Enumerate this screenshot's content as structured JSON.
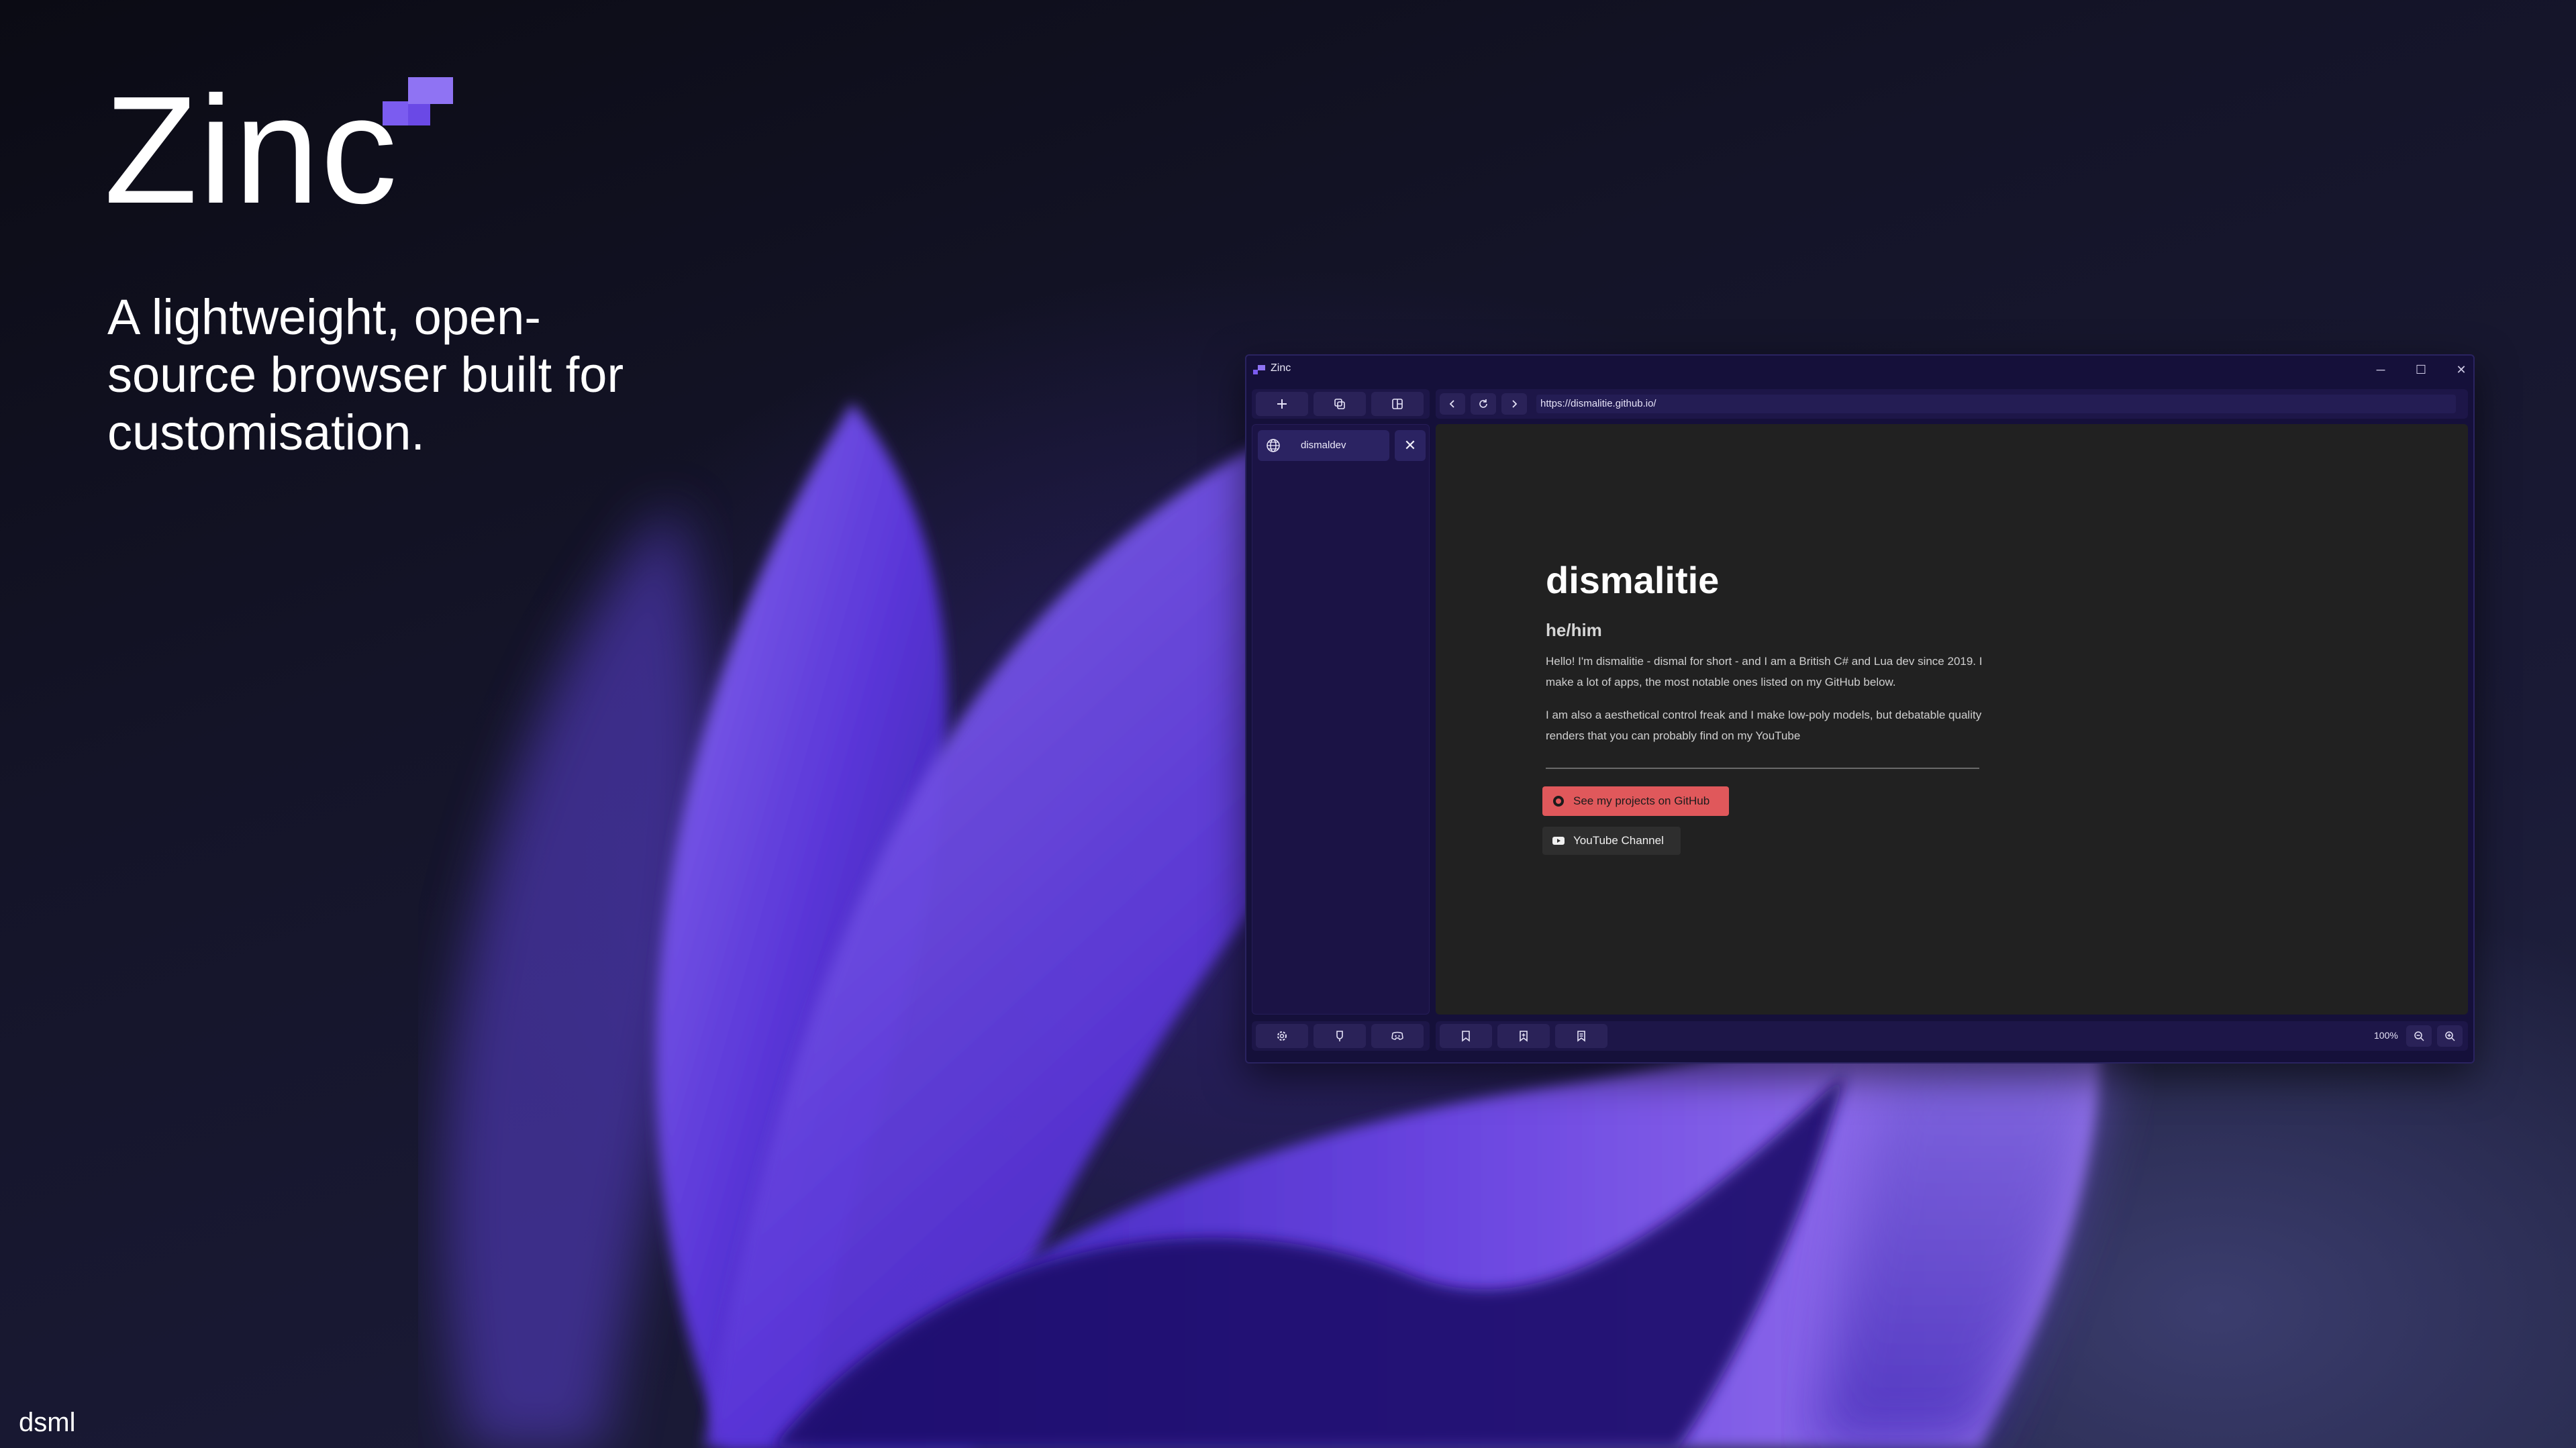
{
  "hero": {
    "wordmark": "Zinc",
    "tagline": "A lightweight, open-source browser built for customisation.",
    "credit": "dsml"
  },
  "window": {
    "title": "Zinc",
    "controls": {
      "minimize": "─",
      "maximize": "☐",
      "close": "✕"
    },
    "toolbar": [
      "new-tab",
      "duplicate-tab",
      "split-view"
    ],
    "nav": {
      "back": "back",
      "reload": "reload",
      "forward": "forward"
    },
    "url": "https://dismalitie.github.io/",
    "tabs": [
      {
        "label": "dismaldev",
        "close": "✕"
      }
    ],
    "page": {
      "title": "dismalitie",
      "pronouns": "he/him",
      "p1": "Hello! I'm dismalitie - dismal for short - and I am a British C# and Lua dev since 2019. I make a lot of apps, the most notable ones listed on my GitHub below.",
      "p2": "I am also a aesthetical control freak and I make low-poly models, but debatable quality renders that you can probably find on my YouTube",
      "github_button": "See my projects on GitHub",
      "youtube_button": "YouTube Channel"
    },
    "bottom_left": [
      "settings",
      "github",
      "discord"
    ],
    "bottom_mid": [
      "bookmark",
      "add-bookmark",
      "bookmarks-list"
    ],
    "zoom": "100%"
  },
  "colors": {
    "accent": "#7b5cf0",
    "github_button": "#e0585b",
    "window_bg": "#15103a",
    "content_bg": "#212121"
  }
}
